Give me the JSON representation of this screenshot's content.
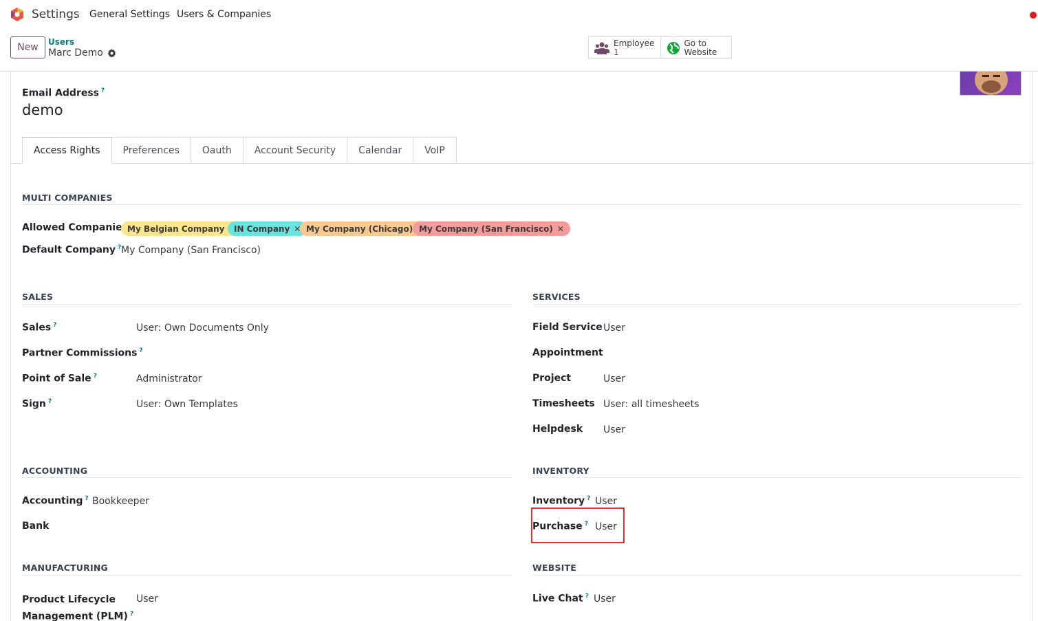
{
  "topbar": {
    "app_title": "Settings",
    "menu": [
      "General Settings",
      "Users & Companies"
    ]
  },
  "control_panel": {
    "new_label": "New",
    "breadcrumb_parent": "Users",
    "record_name": "Marc Demo"
  },
  "smart_buttons": [
    {
      "label": "Employee",
      "value": "1",
      "icon": "users-icon"
    },
    {
      "label": "Go to",
      "label2": "Website",
      "icon": "globe-icon"
    }
  ],
  "form": {
    "email_label": "Email Address",
    "help_mark": "?",
    "login_value": "demo"
  },
  "tabs": [
    "Access Rights",
    "Preferences",
    "Oauth",
    "Account Security",
    "Calendar",
    "VoIP"
  ],
  "multi_companies": {
    "title": "MULTI COMPANIES",
    "allowed_label": "Allowed Companies",
    "allowed_tags": [
      {
        "name": "My Belgian Company",
        "color": "#fde68a"
      },
      {
        "name": "IN Company",
        "color": "#67e4de"
      },
      {
        "name": "My Company (Chicago)",
        "color": "#fbc98e"
      },
      {
        "name": "My Company (San Francisco)",
        "color": "#f69a9a"
      }
    ],
    "default_label": "Default Company",
    "default_value": "My Company (San Francisco)"
  },
  "sales": {
    "title": "SALES",
    "rows": [
      {
        "label": "Sales",
        "value": "User: Own Documents Only"
      },
      {
        "label": "Partner Commissions",
        "value": ""
      },
      {
        "label": "Point of Sale",
        "value": "Administrator"
      },
      {
        "label": "Sign",
        "value": "User: Own Templates"
      }
    ]
  },
  "services": {
    "title": "SERVICES",
    "rows": [
      {
        "label": "Field Service",
        "value": "User"
      },
      {
        "label": "Appointment",
        "value": ""
      },
      {
        "label": "Project",
        "value": "User"
      },
      {
        "label": "Timesheets",
        "value": "User: all timesheets"
      },
      {
        "label": "Helpdesk",
        "value": "User"
      }
    ]
  },
  "accounting": {
    "title": "ACCOUNTING",
    "rows": [
      {
        "label": "Accounting",
        "value": "Bookkeeper"
      },
      {
        "label": "Bank",
        "value": ""
      }
    ]
  },
  "inventory": {
    "title": "INVENTORY",
    "rows": [
      {
        "label": "Inventory",
        "value": "User"
      },
      {
        "label": "Purchase",
        "value": "User"
      }
    ]
  },
  "manufacturing": {
    "title": "MANUFACTURING",
    "rows": [
      {
        "label": "Product Lifecycle",
        "label2": "Management (PLM)",
        "value": "User"
      }
    ]
  },
  "website": {
    "title": "WEBSITE",
    "rows": [
      {
        "label": "Live Chat",
        "value": "User"
      }
    ]
  }
}
